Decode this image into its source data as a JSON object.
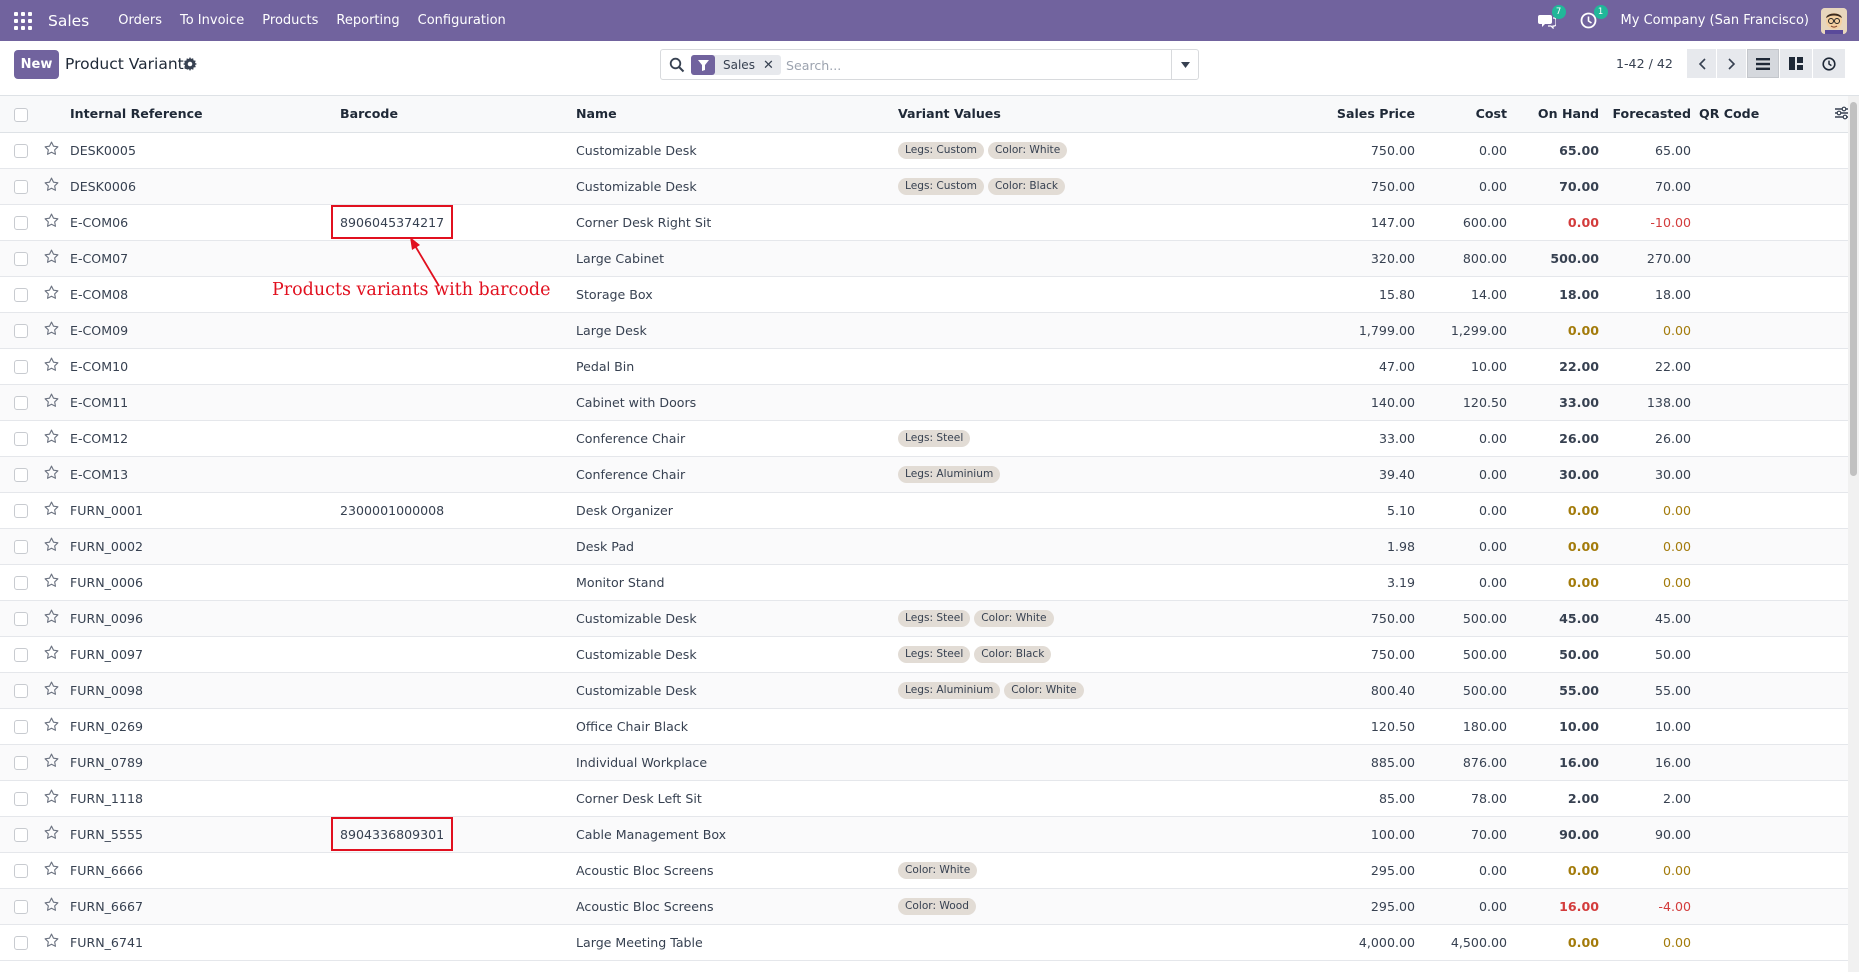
{
  "navbar": {
    "brand": "Sales",
    "menu": [
      "Orders",
      "To Invoice",
      "Products",
      "Reporting",
      "Configuration"
    ],
    "messages_badge": "7",
    "activities_badge": "1",
    "company": "My Company (San Francisco)"
  },
  "control": {
    "new_label": "New",
    "title": "Product Variants",
    "facet": "Sales",
    "search_placeholder": "Search...",
    "pager": "1-42 / 42"
  },
  "columns": {
    "ref": "Internal Reference",
    "barcode": "Barcode",
    "name": "Name",
    "variants": "Variant Values",
    "price": "Sales Price",
    "cost": "Cost",
    "onhand": "On Hand",
    "forecast": "Forecasted",
    "qr": "QR Code"
  },
  "rows": [
    {
      "ref": "DESK0005",
      "barcode": "",
      "name": "Customizable Desk",
      "tags": [
        "Legs: Custom",
        "Color: White"
      ],
      "price": "750.00",
      "cost": "0.00",
      "onhand": "65.00",
      "forecast": "65.00",
      "oh_status": "normal",
      "fc_status": "normal"
    },
    {
      "ref": "DESK0006",
      "barcode": "",
      "name": "Customizable Desk",
      "tags": [
        "Legs: Custom",
        "Color: Black"
      ],
      "price": "750.00",
      "cost": "0.00",
      "onhand": "70.00",
      "forecast": "70.00",
      "oh_status": "normal",
      "fc_status": "normal"
    },
    {
      "ref": "E-COM06",
      "barcode": "8906045374217",
      "name": "Corner Desk Right Sit",
      "tags": [],
      "price": "147.00",
      "cost": "600.00",
      "onhand": "0.00",
      "forecast": "-10.00",
      "oh_status": "negative",
      "fc_status": "negative",
      "highlight": true
    },
    {
      "ref": "E-COM07",
      "barcode": "",
      "name": "Large Cabinet",
      "tags": [],
      "price": "320.00",
      "cost": "800.00",
      "onhand": "500.00",
      "forecast": "270.00",
      "oh_status": "normal",
      "fc_status": "normal"
    },
    {
      "ref": "E-COM08",
      "barcode": "",
      "name": "Storage Box",
      "tags": [],
      "price": "15.80",
      "cost": "14.00",
      "onhand": "18.00",
      "forecast": "18.00",
      "oh_status": "normal",
      "fc_status": "normal"
    },
    {
      "ref": "E-COM09",
      "barcode": "",
      "name": "Large Desk",
      "tags": [],
      "price": "1,799.00",
      "cost": "1,299.00",
      "onhand": "0.00",
      "forecast": "0.00",
      "oh_status": "zero",
      "fc_status": "zero"
    },
    {
      "ref": "E-COM10",
      "barcode": "",
      "name": "Pedal Bin",
      "tags": [],
      "price": "47.00",
      "cost": "10.00",
      "onhand": "22.00",
      "forecast": "22.00",
      "oh_status": "normal",
      "fc_status": "normal"
    },
    {
      "ref": "E-COM11",
      "barcode": "",
      "name": "Cabinet with Doors",
      "tags": [],
      "price": "140.00",
      "cost": "120.50",
      "onhand": "33.00",
      "forecast": "138.00",
      "oh_status": "normal",
      "fc_status": "normal"
    },
    {
      "ref": "E-COM12",
      "barcode": "",
      "name": "Conference Chair",
      "tags": [
        "Legs: Steel"
      ],
      "price": "33.00",
      "cost": "0.00",
      "onhand": "26.00",
      "forecast": "26.00",
      "oh_status": "normal",
      "fc_status": "normal"
    },
    {
      "ref": "E-COM13",
      "barcode": "",
      "name": "Conference Chair",
      "tags": [
        "Legs: Aluminium"
      ],
      "price": "39.40",
      "cost": "0.00",
      "onhand": "30.00",
      "forecast": "30.00",
      "oh_status": "normal",
      "fc_status": "normal"
    },
    {
      "ref": "FURN_0001",
      "barcode": "2300001000008",
      "name": "Desk Organizer",
      "tags": [],
      "price": "5.10",
      "cost": "0.00",
      "onhand": "0.00",
      "forecast": "0.00",
      "oh_status": "zero",
      "fc_status": "zero"
    },
    {
      "ref": "FURN_0002",
      "barcode": "",
      "name": "Desk Pad",
      "tags": [],
      "price": "1.98",
      "cost": "0.00",
      "onhand": "0.00",
      "forecast": "0.00",
      "oh_status": "zero",
      "fc_status": "zero"
    },
    {
      "ref": "FURN_0006",
      "barcode": "",
      "name": "Monitor Stand",
      "tags": [],
      "price": "3.19",
      "cost": "0.00",
      "onhand": "0.00",
      "forecast": "0.00",
      "oh_status": "zero",
      "fc_status": "zero"
    },
    {
      "ref": "FURN_0096",
      "barcode": "",
      "name": "Customizable Desk",
      "tags": [
        "Legs: Steel",
        "Color: White"
      ],
      "price": "750.00",
      "cost": "500.00",
      "onhand": "45.00",
      "forecast": "45.00",
      "oh_status": "normal",
      "fc_status": "normal"
    },
    {
      "ref": "FURN_0097",
      "barcode": "",
      "name": "Customizable Desk",
      "tags": [
        "Legs: Steel",
        "Color: Black"
      ],
      "price": "750.00",
      "cost": "500.00",
      "onhand": "50.00",
      "forecast": "50.00",
      "oh_status": "normal",
      "fc_status": "normal"
    },
    {
      "ref": "FURN_0098",
      "barcode": "",
      "name": "Customizable Desk",
      "tags": [
        "Legs: Aluminium",
        "Color: White"
      ],
      "price": "800.40",
      "cost": "500.00",
      "onhand": "55.00",
      "forecast": "55.00",
      "oh_status": "normal",
      "fc_status": "normal"
    },
    {
      "ref": "FURN_0269",
      "barcode": "",
      "name": "Office Chair Black",
      "tags": [],
      "price": "120.50",
      "cost": "180.00",
      "onhand": "10.00",
      "forecast": "10.00",
      "oh_status": "normal",
      "fc_status": "normal"
    },
    {
      "ref": "FURN_0789",
      "barcode": "",
      "name": "Individual Workplace",
      "tags": [],
      "price": "885.00",
      "cost": "876.00",
      "onhand": "16.00",
      "forecast": "16.00",
      "oh_status": "normal",
      "fc_status": "normal"
    },
    {
      "ref": "FURN_1118",
      "barcode": "",
      "name": "Corner Desk Left Sit",
      "tags": [],
      "price": "85.00",
      "cost": "78.00",
      "onhand": "2.00",
      "forecast": "2.00",
      "oh_status": "normal",
      "fc_status": "normal"
    },
    {
      "ref": "FURN_5555",
      "barcode": "8904336809301",
      "name": "Cable Management Box",
      "tags": [],
      "price": "100.00",
      "cost": "70.00",
      "onhand": "90.00",
      "forecast": "90.00",
      "oh_status": "normal",
      "fc_status": "normal",
      "highlight": true
    },
    {
      "ref": "FURN_6666",
      "barcode": "",
      "name": "Acoustic Bloc Screens",
      "tags": [
        "Color: White"
      ],
      "price": "295.00",
      "cost": "0.00",
      "onhand": "0.00",
      "forecast": "0.00",
      "oh_status": "zero",
      "fc_status": "zero"
    },
    {
      "ref": "FURN_6667",
      "barcode": "",
      "name": "Acoustic Bloc Screens",
      "tags": [
        "Color: Wood"
      ],
      "price": "295.00",
      "cost": "0.00",
      "onhand": "16.00",
      "forecast": "-4.00",
      "oh_status": "negative",
      "fc_status": "negative"
    },
    {
      "ref": "FURN_6741",
      "barcode": "",
      "name": "Large Meeting Table",
      "tags": [],
      "price": "4,000.00",
      "cost": "4,500.00",
      "onhand": "0.00",
      "forecast": "0.00",
      "oh_status": "zero",
      "fc_status": "zero"
    }
  ],
  "annotation": "Products variants with barcode",
  "colors": {
    "brand": "#71639e",
    "annotation": "#e1101f",
    "zero": "#a37b0b",
    "negative": "#d33c3c"
  },
  "icons": [
    "apps-grid-icon",
    "chat-icon",
    "clock-icon",
    "gear-icon",
    "search-icon",
    "filter-icon",
    "close-icon",
    "caret-down-icon",
    "chevron-left-icon",
    "chevron-right-icon",
    "list-view-icon",
    "kanban-view-icon",
    "activity-view-icon",
    "star-icon",
    "column-settings-icon"
  ]
}
